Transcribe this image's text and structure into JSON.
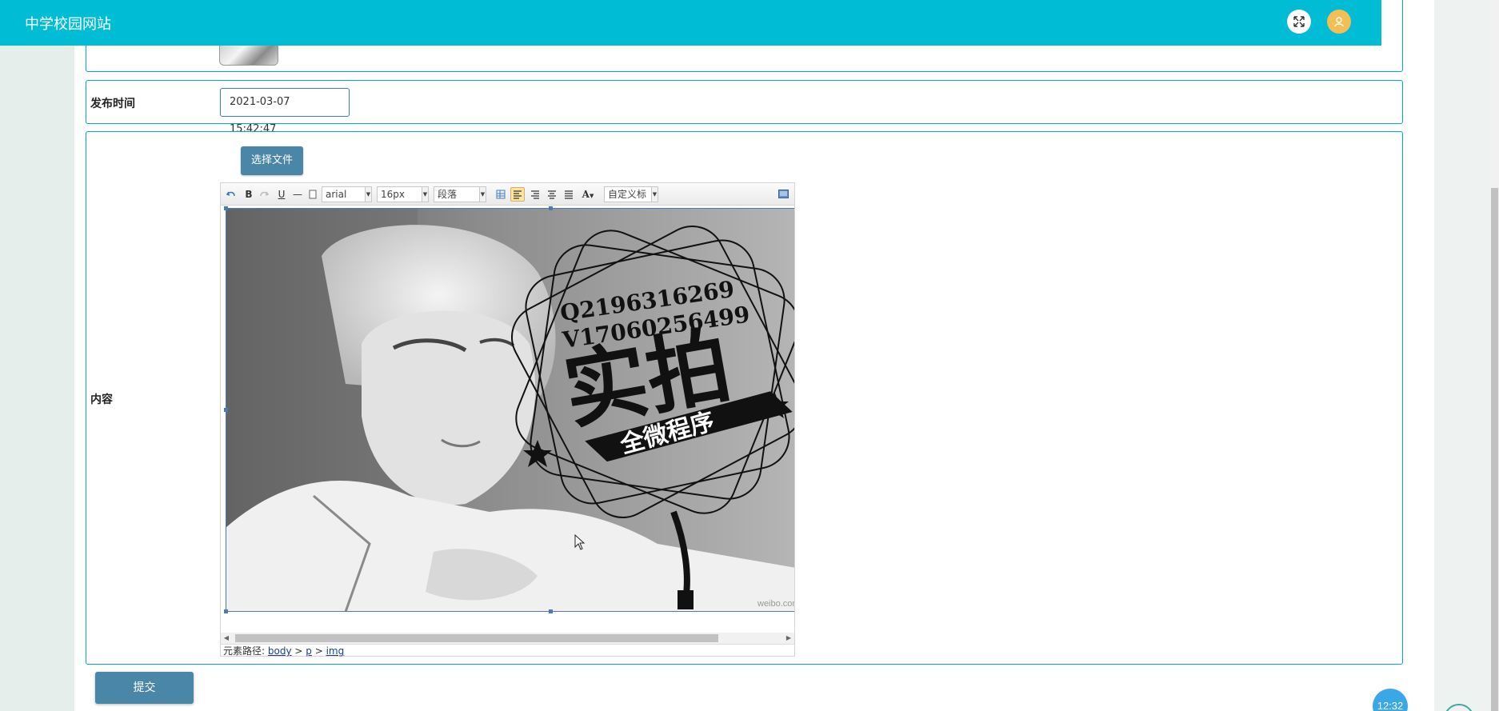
{
  "header": {
    "title": "中学校园网站",
    "icons": {
      "expand": "expand-icon",
      "user": "user-icon"
    }
  },
  "form": {
    "publish_time_label": "发布时间",
    "publish_time_value": "2021-03-07 15:42:47",
    "content_label": "内容",
    "choose_file_label": "选择文件",
    "submit_label": "提交"
  },
  "editor": {
    "toolbar": {
      "undo": "undo-icon",
      "bold": "B",
      "redo": "redo-icon",
      "underline": "U",
      "hr": "—",
      "font_family": "arial",
      "font_size": "16px",
      "paragraph": "段落",
      "custom_title": "自定义标",
      "font_color": "A"
    },
    "path_label": "元素路径:",
    "path": [
      "body",
      "p",
      "img"
    ],
    "image_text": {
      "q_line": "Q2196316269",
      "v_line": "V17060256499",
      "big": "实拍",
      "ribbon": "全微程序",
      "wm": "weibo.com/u"
    }
  },
  "widgets": {
    "clock": "12:32"
  },
  "colors": {
    "topbar": "#00bcd4",
    "panel_border": "#00a7bd",
    "button": "#4a86a8",
    "user_avatar": "#f3bf53"
  }
}
